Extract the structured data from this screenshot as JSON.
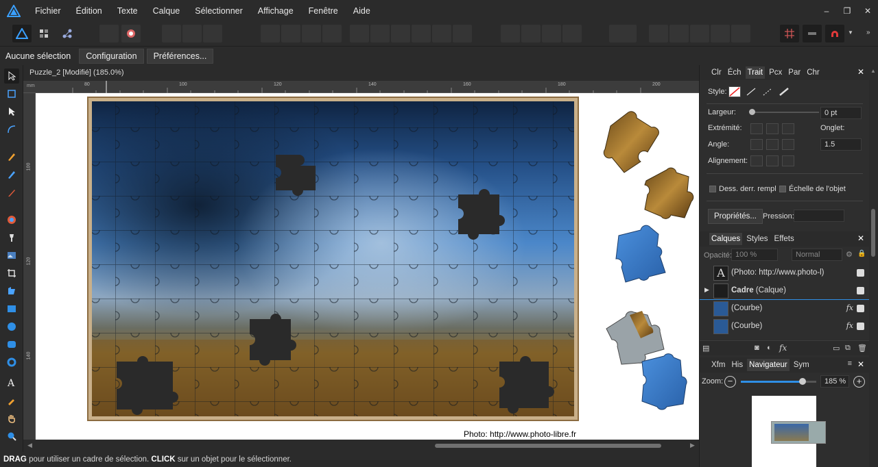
{
  "menu": {
    "items": [
      "Fichier",
      "Édition",
      "Texte",
      "Calque",
      "Sélectionner",
      "Affichage",
      "Fenêtre",
      "Aide"
    ],
    "window_controls": [
      "–",
      "❐",
      "✕"
    ]
  },
  "context": {
    "selection_label": "Aucune sélection",
    "configuration_button": "Configuration",
    "preferences_button": "Préférences..."
  },
  "document": {
    "tab_title": "Puzzle_2 [Modifié] (185.0%)",
    "ruler_unit": "mm",
    "ruler_h_ticks": [
      "80",
      "100",
      "120",
      "140",
      "160",
      "180",
      "200"
    ],
    "ruler_v_ticks": [
      "100",
      "120",
      "140"
    ],
    "caption": "Photo: http://www.photo-libre.fr"
  },
  "status": {
    "drag_key": "DRAG",
    "drag_text": " pour utiliser un cadre de sélection. ",
    "click_key": "CLICK",
    "click_text": " sur un objet pour le sélectionner."
  },
  "stroke_panel": {
    "tabs": [
      "Clr",
      "Éch",
      "Trait",
      "Pcx",
      "Par",
      "Chr"
    ],
    "active_tab": "Trait",
    "style_label": "Style:",
    "width_label": "Largeur:",
    "width_value": "0 pt",
    "cap_label": "Extrémité:",
    "miter_label": "Onglet:",
    "angle_label": "Angle:",
    "miter_value": "1.5",
    "align_label": "Alignement:",
    "draw_behind_label": "Dess. derr. rempl",
    "scale_object_label": "Échelle de l'objet",
    "properties_button": "Propriétés...",
    "pressure_label": "Pression:"
  },
  "layers_panel": {
    "tabs": [
      "Calques",
      "Styles",
      "Effets"
    ],
    "active_tab": "Calques",
    "opacity_label": "Opacité:",
    "opacity_value": "100 %",
    "blend_mode": "Normal",
    "rows": [
      {
        "name": "(Photo: http://www.photo-l)",
        "bold": "",
        "fx": ""
      },
      {
        "name": " (Calque)",
        "bold": "Cadre",
        "fx": ""
      },
      {
        "name": "(Courbe)",
        "bold": "",
        "fx": "fx"
      },
      {
        "name": "(Courbe)",
        "bold": "",
        "fx": "fx"
      }
    ],
    "fx_label": "fx"
  },
  "navigator_panel": {
    "tabs": [
      "Xfm",
      "His",
      "Navigateur",
      "Sym"
    ],
    "active_tab": "Navigateur",
    "zoom_label": "Zoom:",
    "zoom_value": "185 %",
    "zoom_fraction": 0.82
  },
  "colors": {
    "accent": "#2f8fe6",
    "bg": "#2b2b2b",
    "panel": "#2e2e2e"
  }
}
